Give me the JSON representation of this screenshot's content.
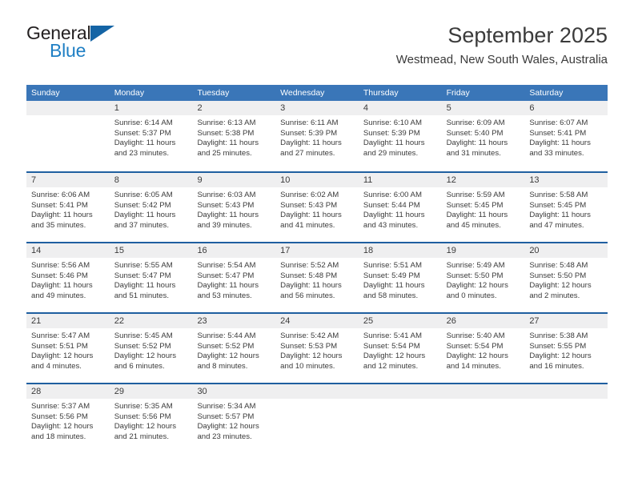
{
  "brand": {
    "name_top": "General",
    "name_bottom": "Blue",
    "top_color": "#231f20",
    "bottom_color": "#1f7fc4",
    "triangle_color": "#1464a5",
    "triangle_icon": "triangle-icon"
  },
  "header": {
    "title": "September 2025",
    "subtitle": "Westmead, New South Wales, Australia"
  },
  "theme": {
    "header_bar_color": "#3a76b8",
    "week_divider_color": "#1f5fa0",
    "day_number_band": "#efeff0",
    "text_color": "#3b3b3b"
  },
  "weekdays": [
    "Sunday",
    "Monday",
    "Tuesday",
    "Wednesday",
    "Thursday",
    "Friday",
    "Saturday"
  ],
  "weeks": [
    [
      {
        "day": "",
        "lines": []
      },
      {
        "day": "1",
        "lines": [
          "Sunrise: 6:14 AM",
          "Sunset: 5:37 PM",
          "Daylight: 11 hours",
          "and 23 minutes."
        ]
      },
      {
        "day": "2",
        "lines": [
          "Sunrise: 6:13 AM",
          "Sunset: 5:38 PM",
          "Daylight: 11 hours",
          "and 25 minutes."
        ]
      },
      {
        "day": "3",
        "lines": [
          "Sunrise: 6:11 AM",
          "Sunset: 5:39 PM",
          "Daylight: 11 hours",
          "and 27 minutes."
        ]
      },
      {
        "day": "4",
        "lines": [
          "Sunrise: 6:10 AM",
          "Sunset: 5:39 PM",
          "Daylight: 11 hours",
          "and 29 minutes."
        ]
      },
      {
        "day": "5",
        "lines": [
          "Sunrise: 6:09 AM",
          "Sunset: 5:40 PM",
          "Daylight: 11 hours",
          "and 31 minutes."
        ]
      },
      {
        "day": "6",
        "lines": [
          "Sunrise: 6:07 AM",
          "Sunset: 5:41 PM",
          "Daylight: 11 hours",
          "and 33 minutes."
        ]
      }
    ],
    [
      {
        "day": "7",
        "lines": [
          "Sunrise: 6:06 AM",
          "Sunset: 5:41 PM",
          "Daylight: 11 hours",
          "and 35 minutes."
        ]
      },
      {
        "day": "8",
        "lines": [
          "Sunrise: 6:05 AM",
          "Sunset: 5:42 PM",
          "Daylight: 11 hours",
          "and 37 minutes."
        ]
      },
      {
        "day": "9",
        "lines": [
          "Sunrise: 6:03 AM",
          "Sunset: 5:43 PM",
          "Daylight: 11 hours",
          "and 39 minutes."
        ]
      },
      {
        "day": "10",
        "lines": [
          "Sunrise: 6:02 AM",
          "Sunset: 5:43 PM",
          "Daylight: 11 hours",
          "and 41 minutes."
        ]
      },
      {
        "day": "11",
        "lines": [
          "Sunrise: 6:00 AM",
          "Sunset: 5:44 PM",
          "Daylight: 11 hours",
          "and 43 minutes."
        ]
      },
      {
        "day": "12",
        "lines": [
          "Sunrise: 5:59 AM",
          "Sunset: 5:45 PM",
          "Daylight: 11 hours",
          "and 45 minutes."
        ]
      },
      {
        "day": "13",
        "lines": [
          "Sunrise: 5:58 AM",
          "Sunset: 5:45 PM",
          "Daylight: 11 hours",
          "and 47 minutes."
        ]
      }
    ],
    [
      {
        "day": "14",
        "lines": [
          "Sunrise: 5:56 AM",
          "Sunset: 5:46 PM",
          "Daylight: 11 hours",
          "and 49 minutes."
        ]
      },
      {
        "day": "15",
        "lines": [
          "Sunrise: 5:55 AM",
          "Sunset: 5:47 PM",
          "Daylight: 11 hours",
          "and 51 minutes."
        ]
      },
      {
        "day": "16",
        "lines": [
          "Sunrise: 5:54 AM",
          "Sunset: 5:47 PM",
          "Daylight: 11 hours",
          "and 53 minutes."
        ]
      },
      {
        "day": "17",
        "lines": [
          "Sunrise: 5:52 AM",
          "Sunset: 5:48 PM",
          "Daylight: 11 hours",
          "and 56 minutes."
        ]
      },
      {
        "day": "18",
        "lines": [
          "Sunrise: 5:51 AM",
          "Sunset: 5:49 PM",
          "Daylight: 11 hours",
          "and 58 minutes."
        ]
      },
      {
        "day": "19",
        "lines": [
          "Sunrise: 5:49 AM",
          "Sunset: 5:50 PM",
          "Daylight: 12 hours",
          "and 0 minutes."
        ]
      },
      {
        "day": "20",
        "lines": [
          "Sunrise: 5:48 AM",
          "Sunset: 5:50 PM",
          "Daylight: 12 hours",
          "and 2 minutes."
        ]
      }
    ],
    [
      {
        "day": "21",
        "lines": [
          "Sunrise: 5:47 AM",
          "Sunset: 5:51 PM",
          "Daylight: 12 hours",
          "and 4 minutes."
        ]
      },
      {
        "day": "22",
        "lines": [
          "Sunrise: 5:45 AM",
          "Sunset: 5:52 PM",
          "Daylight: 12 hours",
          "and 6 minutes."
        ]
      },
      {
        "day": "23",
        "lines": [
          "Sunrise: 5:44 AM",
          "Sunset: 5:52 PM",
          "Daylight: 12 hours",
          "and 8 minutes."
        ]
      },
      {
        "day": "24",
        "lines": [
          "Sunrise: 5:42 AM",
          "Sunset: 5:53 PM",
          "Daylight: 12 hours",
          "and 10 minutes."
        ]
      },
      {
        "day": "25",
        "lines": [
          "Sunrise: 5:41 AM",
          "Sunset: 5:54 PM",
          "Daylight: 12 hours",
          "and 12 minutes."
        ]
      },
      {
        "day": "26",
        "lines": [
          "Sunrise: 5:40 AM",
          "Sunset: 5:54 PM",
          "Daylight: 12 hours",
          "and 14 minutes."
        ]
      },
      {
        "day": "27",
        "lines": [
          "Sunrise: 5:38 AM",
          "Sunset: 5:55 PM",
          "Daylight: 12 hours",
          "and 16 minutes."
        ]
      }
    ],
    [
      {
        "day": "28",
        "lines": [
          "Sunrise: 5:37 AM",
          "Sunset: 5:56 PM",
          "Daylight: 12 hours",
          "and 18 minutes."
        ]
      },
      {
        "day": "29",
        "lines": [
          "Sunrise: 5:35 AM",
          "Sunset: 5:56 PM",
          "Daylight: 12 hours",
          "and 21 minutes."
        ]
      },
      {
        "day": "30",
        "lines": [
          "Sunrise: 5:34 AM",
          "Sunset: 5:57 PM",
          "Daylight: 12 hours",
          "and 23 minutes."
        ]
      },
      {
        "day": "",
        "lines": []
      },
      {
        "day": "",
        "lines": []
      },
      {
        "day": "",
        "lines": []
      },
      {
        "day": "",
        "lines": []
      }
    ]
  ]
}
